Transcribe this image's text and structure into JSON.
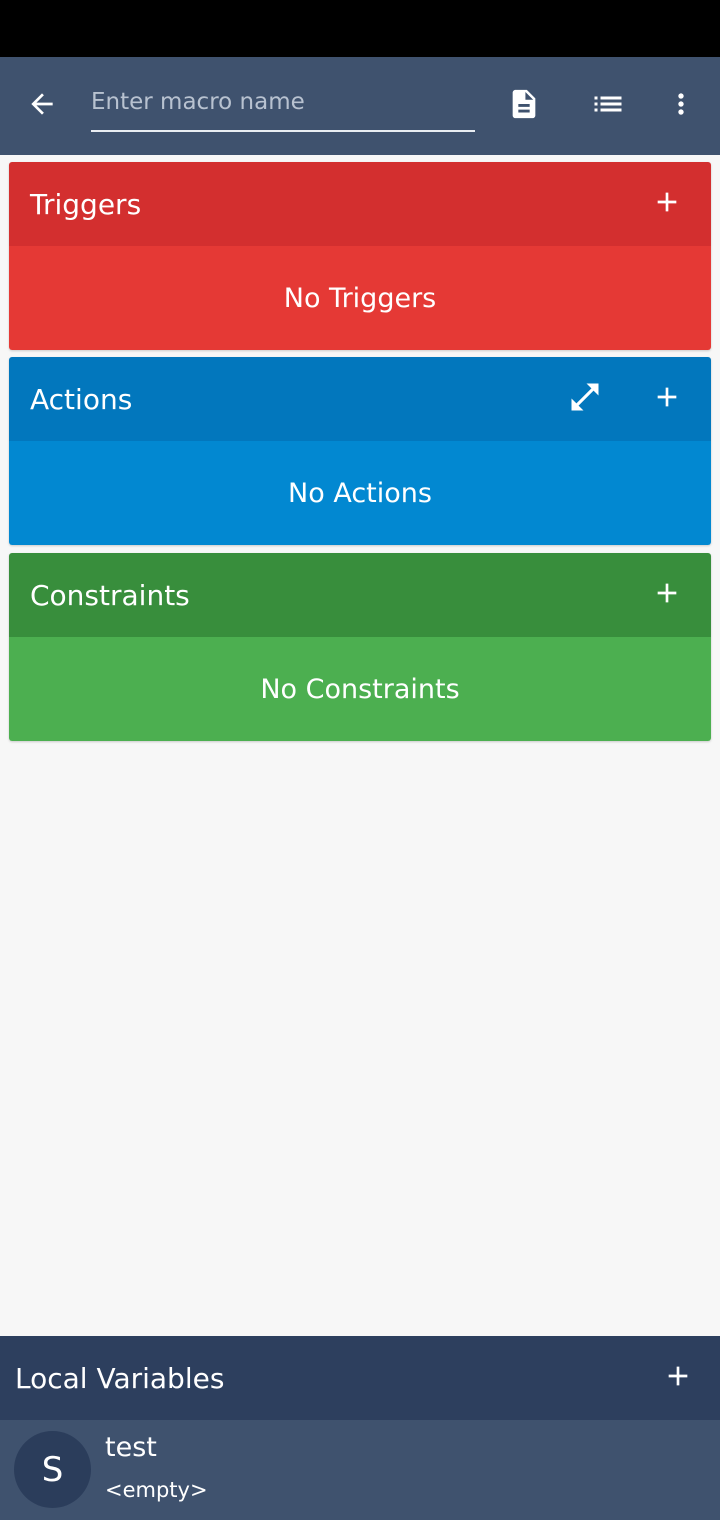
{
  "colors": {
    "toolbar": "#3f526e",
    "triggers_header": "#d32f2f",
    "triggers_body": "#e53935",
    "actions_header": "#0277bd",
    "actions_body": "#0288d1",
    "constraints_header": "#388e3c",
    "constraints_body": "#4caf50",
    "variables_header": "#2d3f5e",
    "variables_row": "#3f526e"
  },
  "toolbar": {
    "name_placeholder": "Enter macro name",
    "icons": [
      "arrow-left-icon",
      "document-icon",
      "list-icon",
      "more-vertical-icon"
    ]
  },
  "sections": {
    "triggers": {
      "title": "Triggers",
      "empty_text": "No Triggers"
    },
    "actions": {
      "title": "Actions",
      "empty_text": "No Actions"
    },
    "constraints": {
      "title": "Constraints",
      "empty_text": "No Constraints"
    }
  },
  "local_variables": {
    "title": "Local Variables",
    "items": [
      {
        "type_letter": "S",
        "name": "test",
        "value": "<empty>"
      }
    ]
  }
}
